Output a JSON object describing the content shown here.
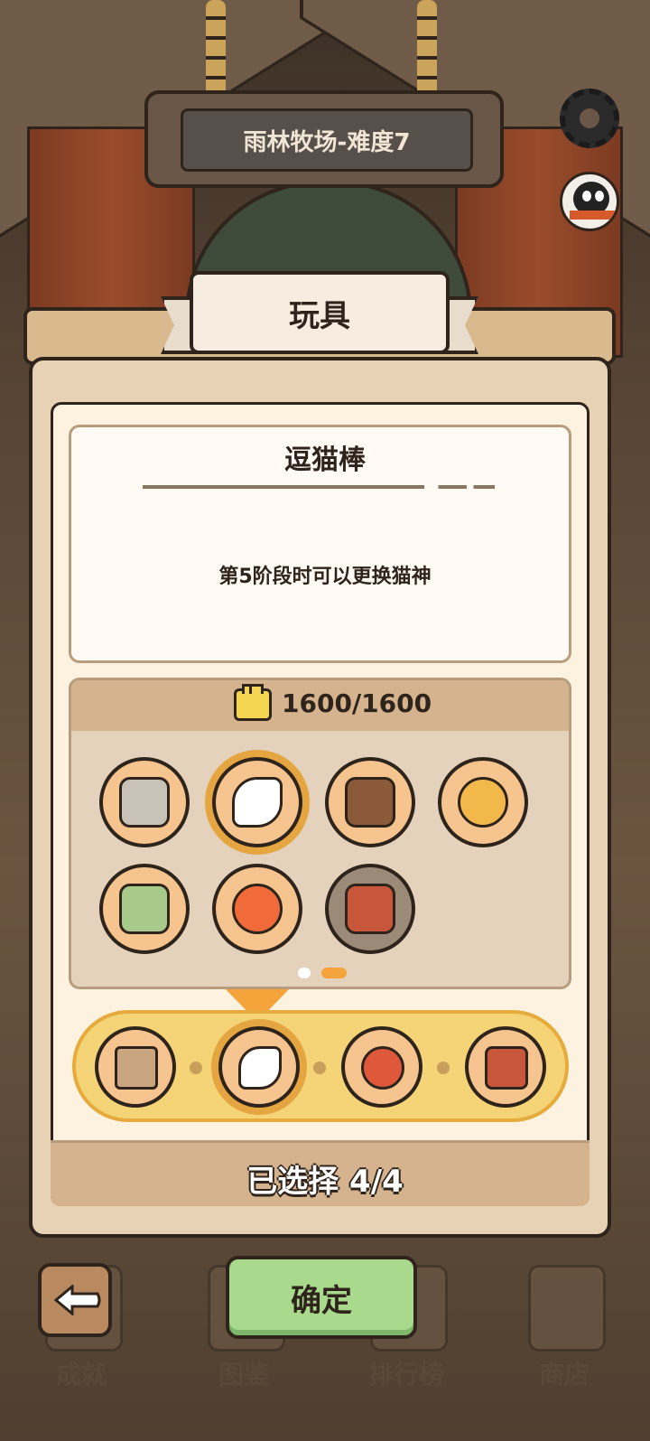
{
  "header": {
    "level_title": "雨林牧场-难度7"
  },
  "panel": {
    "title": "玩具",
    "item_name": "逗猫棒",
    "item_description": "第5阶段时可以更换猫神",
    "currency": "1600/1600",
    "selected_count": "已选择 4/4"
  },
  "inventory": [
    {
      "name": "cat-food-jar-icon",
      "color": "#f6c58f"
    },
    {
      "name": "cat-teaser-wand-icon",
      "color": "#f6c58f",
      "selected": true
    },
    {
      "name": "bear-puppet-icon",
      "color": "#f6c58f"
    },
    {
      "name": "colorful-ring-toy-icon",
      "color": "#f6c58f"
    },
    {
      "name": "cattail-plant-icon",
      "color": "#f6c58f"
    },
    {
      "name": "goldfish-toy-icon",
      "color": "#f6c58f"
    },
    {
      "name": "electric-shaver-icon",
      "color": "#9c8a78"
    }
  ],
  "pagination": {
    "pages": 2,
    "current": 2
  },
  "selected_slots": [
    {
      "name": "cardboard-box-icon"
    },
    {
      "name": "cat-teaser-wand-icon",
      "active": true
    },
    {
      "name": "daruma-cat-icon"
    },
    {
      "name": "electric-shaver-icon"
    }
  ],
  "bottom_nav": {
    "achievements": "成就",
    "collection": "图鉴",
    "leaderboard": "排行榜",
    "shop": "商店",
    "confirm": "确定"
  },
  "colors": {
    "confirm_green": "#a8d98c",
    "slot_bar_yellow": "#f4d477",
    "selected_ring": "#e5a540",
    "page_dot_active": "#f4a43a"
  }
}
